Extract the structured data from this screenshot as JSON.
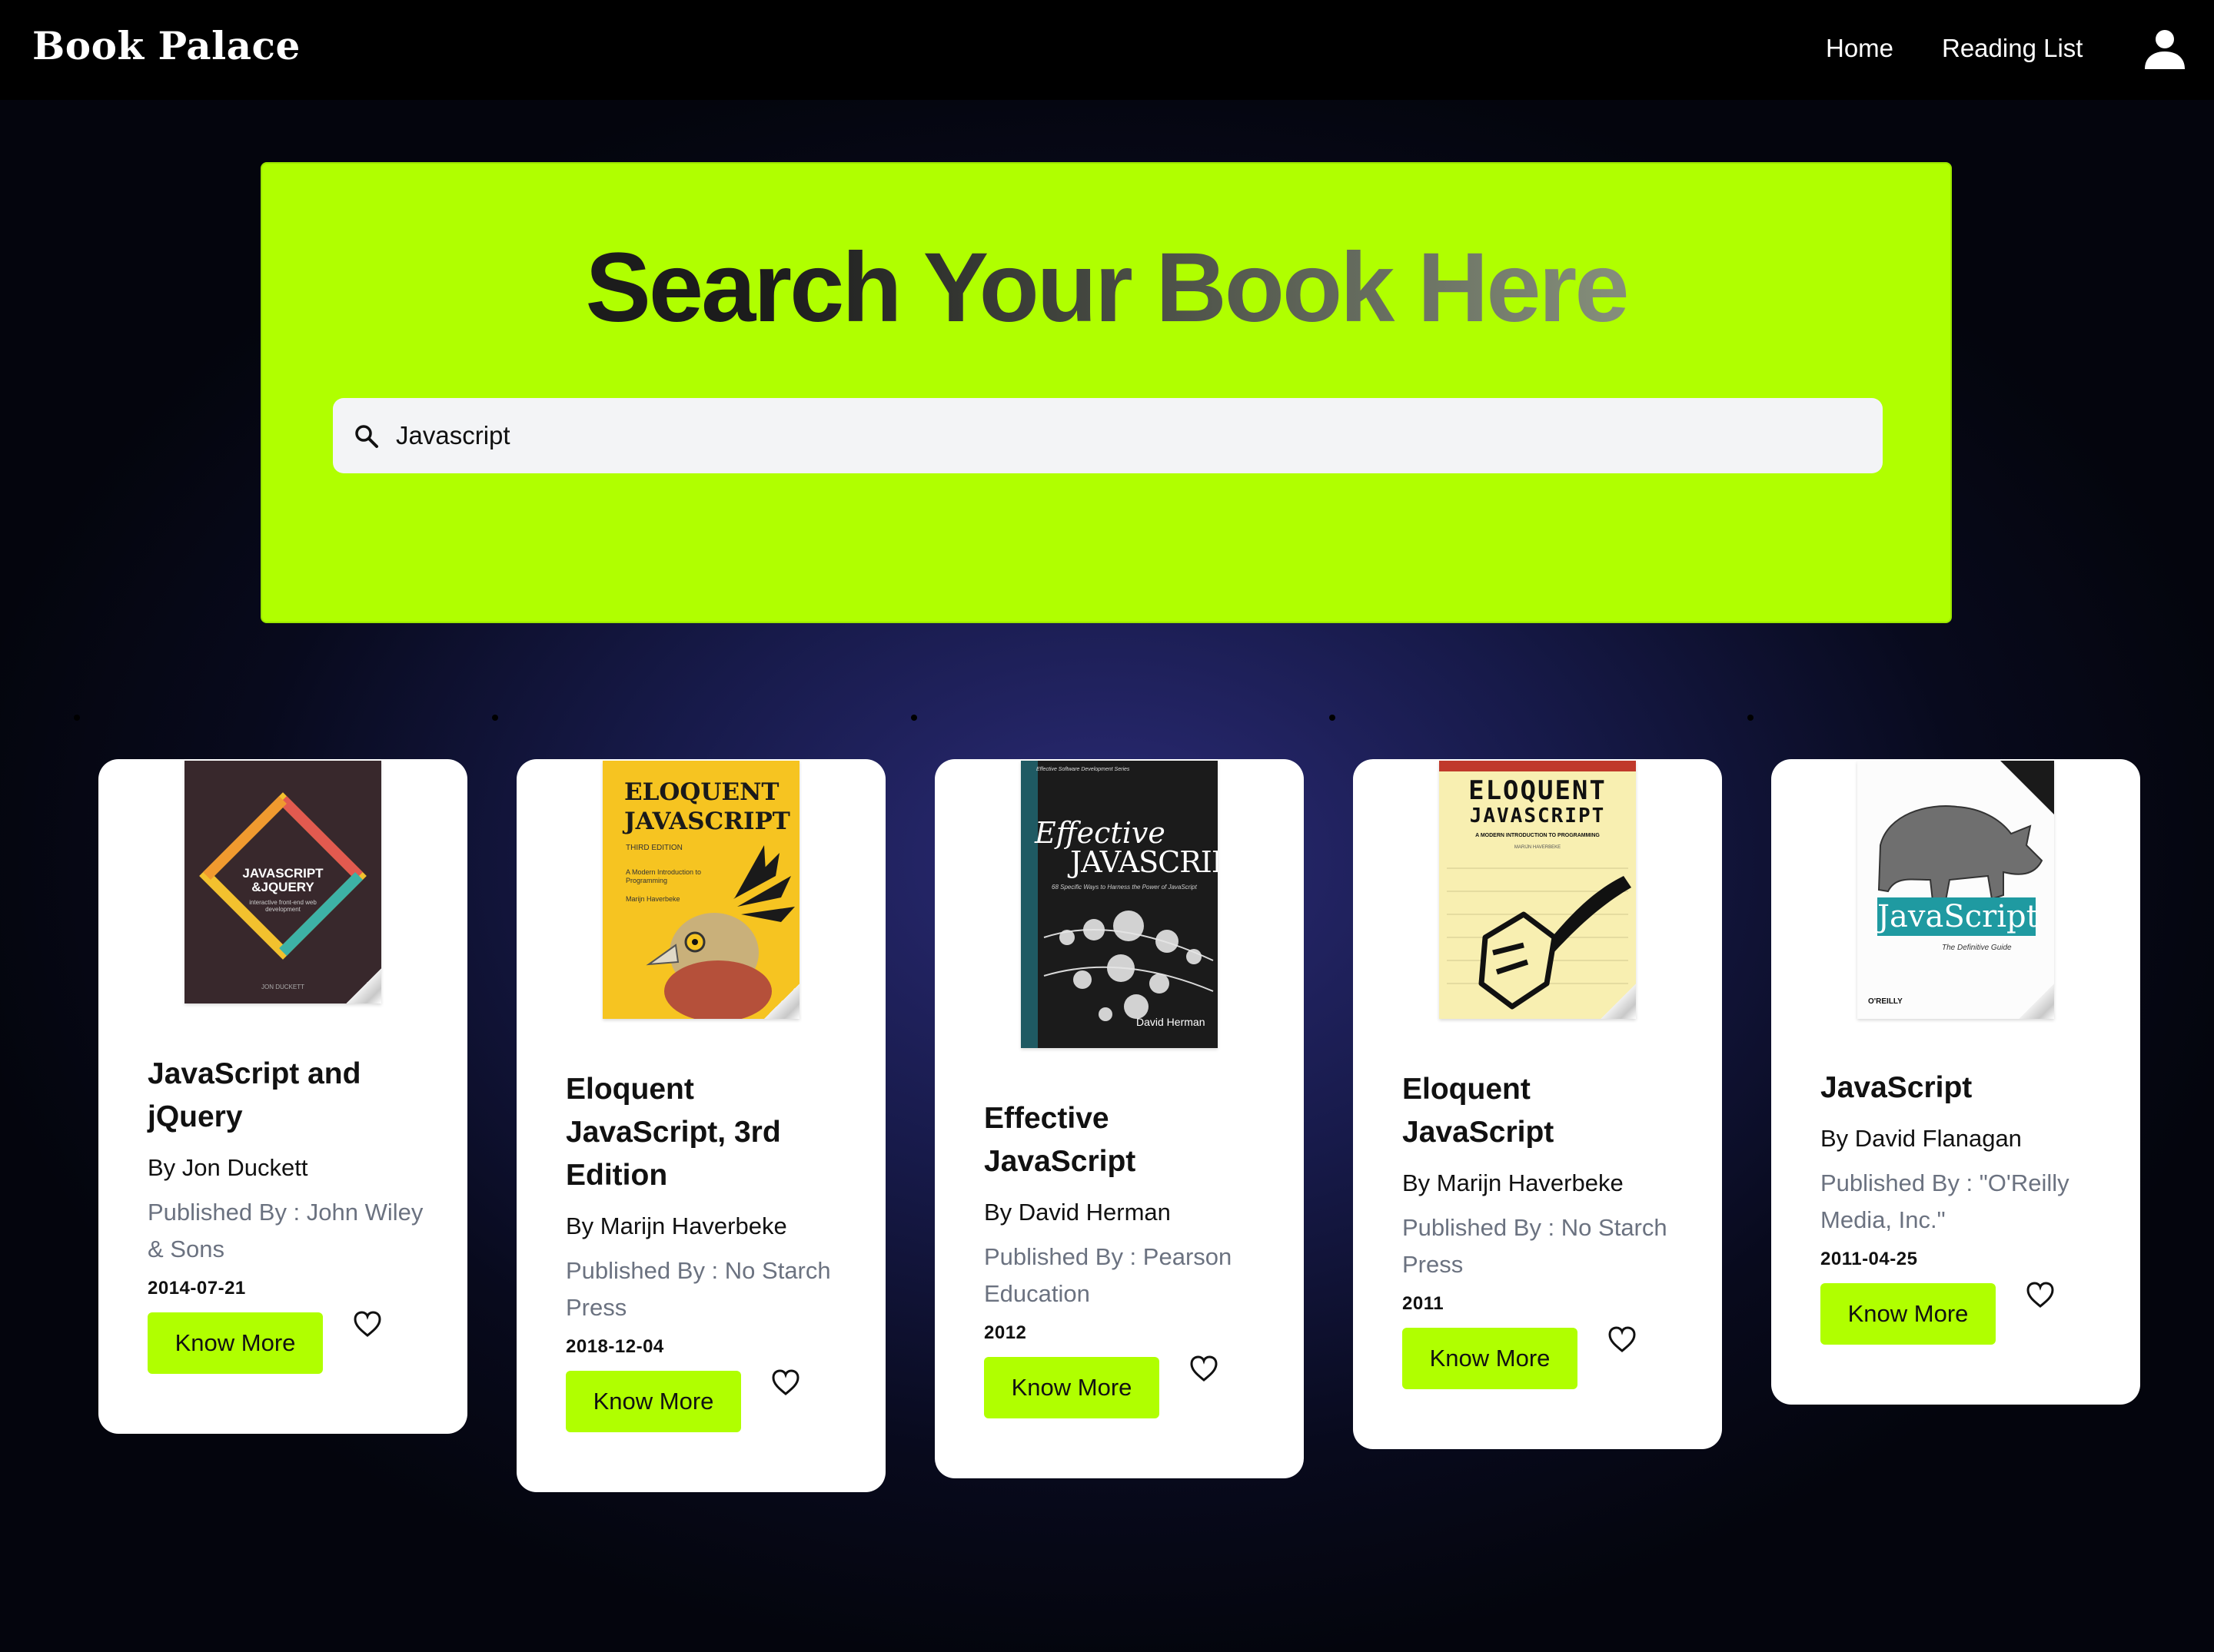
{
  "app": {
    "brand": "Book Palace"
  },
  "nav": {
    "home": "Home",
    "reading_list": "Reading List"
  },
  "icons": {
    "user": "user-icon",
    "search": "search-icon",
    "favorite": "heart-outline-icon"
  },
  "colors": {
    "accent": "#b0ff00",
    "topbar": "#000000",
    "card": "#ffffff",
    "publisher_text": "#6b7280"
  },
  "hero": {
    "title": "Search Your Book Here",
    "search_value": "Javascript"
  },
  "books": [
    {
      "title": "JavaScript and jQuery",
      "author": "By Jon Duckett",
      "publisher": "Published By : John Wiley & Sons",
      "date": "2014-07-21",
      "button": "Know More",
      "cover": {
        "line1": "JAVASCRIPT",
        "line2": "&JQUERY",
        "tagline": "interactive front-end web development",
        "author": "JON DUCKETT"
      }
    },
    {
      "title": "Eloquent JavaScript, 3rd Edition",
      "author": "By Marijn Haverbeke",
      "publisher": "Published By : No Starch Press",
      "date": "2018-12-04",
      "button": "Know More",
      "cover": {
        "line1": "ELOQUENT",
        "line2": "JAVASCRIPT",
        "edition": "THIRD EDITION",
        "tagline": "A Modern Introduction to Programming",
        "author": "Marijn Haverbeke"
      }
    },
    {
      "title": "Effective JavaScript",
      "author": "By David Herman",
      "publisher": "Published By : Pearson Education",
      "date": "2012",
      "button": "Know More",
      "cover": {
        "series": "Effective Software Development Series",
        "line1": "Effective",
        "line2": "JAVASCRIPT",
        "tagline": "68 Specific Ways to Harness the Power of JavaScript",
        "author": "David Herman"
      }
    },
    {
      "title": "Eloquent JavaScript",
      "author": "By Marijn Haverbeke",
      "publisher": "Published By : No Starch Press",
      "date": "2011",
      "button": "Know More",
      "cover": {
        "line1": "ELOQUENT",
        "line2": "JAVASCRIPT",
        "tagline": "A MODERN INTRODUCTION TO PROGRAMMING",
        "author": "MARIJN HAVERBEKE"
      }
    },
    {
      "title": "JavaScript",
      "author": "By David Flanagan",
      "publisher": "Published By : \"O'Reilly Media, Inc.\"",
      "date": "2011-04-25",
      "button": "Know More",
      "cover": {
        "line1": "JavaScript",
        "subtitle": "The Definitive Guide",
        "publisher": "O'REILLY"
      }
    }
  ]
}
